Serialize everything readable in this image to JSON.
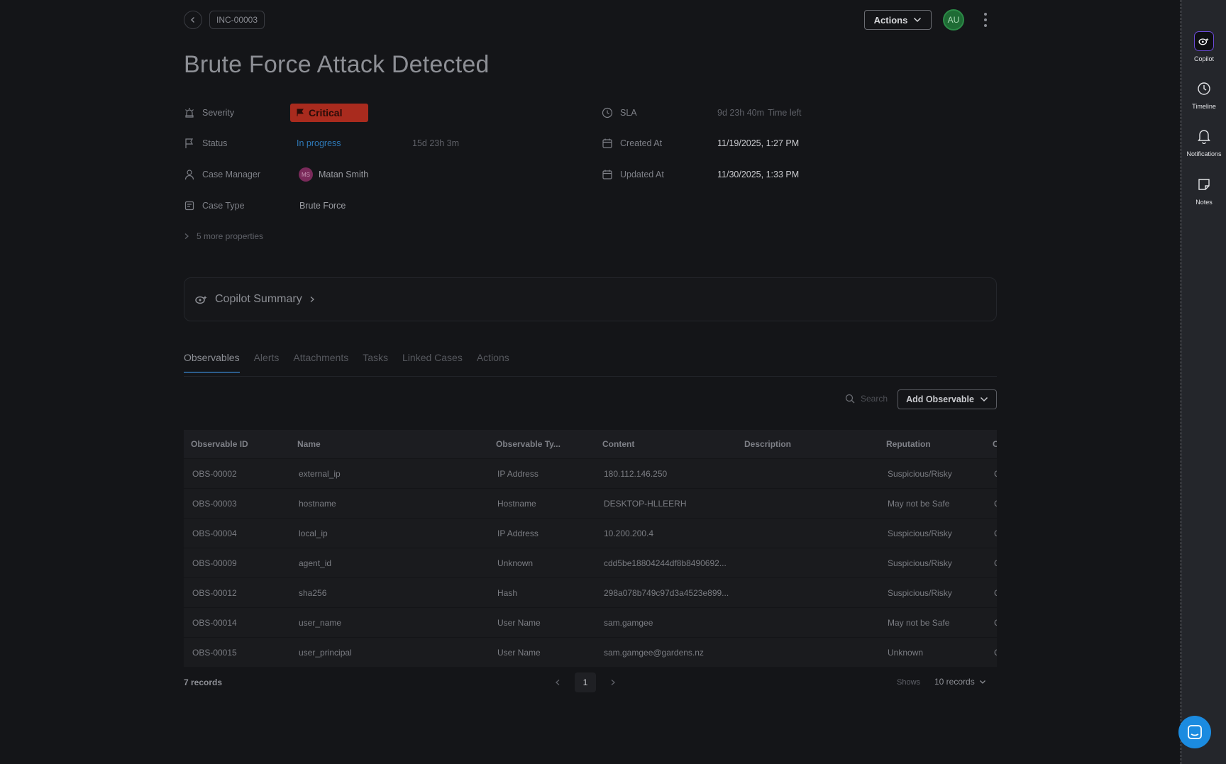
{
  "header": {
    "case_id": "INC-00003",
    "actions_label": "Actions",
    "avatar_initials": "AU",
    "title": "Brute Force Attack Detected"
  },
  "properties": {
    "severity_label": "Severity",
    "severity_value": "Critical",
    "status_label": "Status",
    "status_value": "In progress",
    "status_duration": "15d 23h 3m",
    "case_manager_label": "Case Manager",
    "case_manager_initials": "MS",
    "case_manager_name": "Matan Smith",
    "case_type_label": "Case Type",
    "case_type_value": "Brute Force",
    "sla_label": "SLA",
    "sla_value": "9d 23h 40m",
    "sla_suffix": "Time left",
    "created_label": "Created At",
    "created_value": "11/19/2025, 1:27 PM",
    "updated_label": "Updated At",
    "updated_value": "11/30/2025, 1:33 PM",
    "more_properties": "5 more properties"
  },
  "copilot_summary": {
    "title": "Copilot Summary"
  },
  "tabs": [
    {
      "label": "Observables",
      "active": true
    },
    {
      "label": "Alerts"
    },
    {
      "label": "Attachments"
    },
    {
      "label": "Tasks"
    },
    {
      "label": "Linked Cases"
    },
    {
      "label": "Actions"
    }
  ],
  "toolbar": {
    "search_placeholder": "Search",
    "add_observable_label": "Add Observable"
  },
  "table": {
    "columns": [
      "Observable ID",
      "Name",
      "Observable Ty...",
      "Content",
      "Description",
      "Reputation",
      "C"
    ],
    "rows": [
      {
        "id": "OBS-00002",
        "name": "external_ip",
        "type": "IP Address",
        "content": "180.112.146.250",
        "description": "",
        "reputation": "Suspicious/Risky",
        "extra": "C"
      },
      {
        "id": "OBS-00003",
        "name": "hostname",
        "type": "Hostname",
        "content": "DESKTOP-HLLEERH",
        "description": "",
        "reputation": "May not be Safe",
        "extra": "C"
      },
      {
        "id": "OBS-00004",
        "name": "local_ip",
        "type": "IP Address",
        "content": "10.200.200.4",
        "description": "",
        "reputation": "Suspicious/Risky",
        "extra": "C"
      },
      {
        "id": "OBS-00009",
        "name": "agent_id",
        "type": "Unknown",
        "content": "cdd5be18804244df8b8490692...",
        "description": "",
        "reputation": "Suspicious/Risky",
        "extra": "C"
      },
      {
        "id": "OBS-00012",
        "name": "sha256",
        "type": "Hash",
        "content": "298a078b749c97d3a4523e899...",
        "description": "",
        "reputation": "Suspicious/Risky",
        "extra": "C"
      },
      {
        "id": "OBS-00014",
        "name": "user_name",
        "type": "User Name",
        "content": "sam.gamgee",
        "description": "",
        "reputation": "May not be Safe",
        "extra": "C"
      },
      {
        "id": "OBS-00015",
        "name": "user_principal",
        "type": "User Name",
        "content": "sam.gamgee@gardens.nz",
        "description": "",
        "reputation": "Unknown",
        "extra": "C"
      }
    ]
  },
  "footer": {
    "records_count": "7 records",
    "current_page": "1",
    "shows_label": "Shows",
    "per_page": "10 records"
  },
  "rail": {
    "items": [
      {
        "label": "Copilot",
        "icon": "copilot-icon"
      },
      {
        "label": "Timeline",
        "icon": "clock-icon"
      },
      {
        "label": "Notifications",
        "icon": "bell-icon"
      },
      {
        "label": "Notes",
        "icon": "note-icon"
      }
    ]
  },
  "colors": {
    "background": "#141518",
    "critical": "#a92b1e",
    "status_link": "#2e79b8",
    "accent_blue": "#1b8be0",
    "avatar_green": "#1e6b34"
  }
}
